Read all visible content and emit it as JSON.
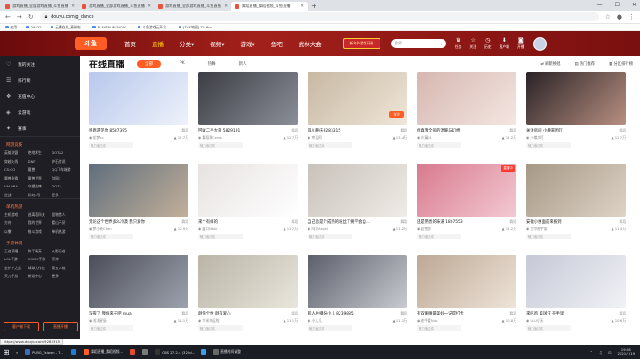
{
  "browser": {
    "tabs": [
      {
        "title": "游戏直播_全部游戏直播_斗鱼直播",
        "active": false
      },
      {
        "title": "游戏直播_全部游戏直播_斗鱼直播",
        "active": false
      },
      {
        "title": "游戏直播_全部游戏直播_斗鱼直播",
        "active": false
      },
      {
        "title": "舞蹈直播_舞蹈视频_斗鱼直播",
        "active": true
      }
    ],
    "url": "douyu.com/g_dance",
    "bookmarks": [
      "应用",
      "29422",
      "云播在线_直播电...",
      "PLAYERUNKNOW...",
      "斗鱼游戏云开发...",
      "[TGS地图] TG Pro..."
    ],
    "window_controls": [
      "—",
      "☐",
      "✕"
    ]
  },
  "header": {
    "logo": "斗鱼",
    "nav": [
      "首页",
      "直播",
      "分类▾",
      "视频▾",
      "游戏▾",
      "鱼吧",
      "武林大会"
    ],
    "nav_selected": 1,
    "promo": "新年节游戏开播",
    "search_placeholder": "搜索",
    "icons": [
      {
        "icon": "trophy-icon",
        "glyph": "♛",
        "label": "任务"
      },
      {
        "icon": "star-icon",
        "glyph": "☆",
        "label": "关注"
      },
      {
        "icon": "history-icon",
        "glyph": "◷",
        "label": "历史"
      },
      {
        "icon": "download-icon",
        "glyph": "⬇",
        "label": "客户端"
      },
      {
        "icon": "camera-icon",
        "glyph": "◙",
        "label": "开播"
      }
    ]
  },
  "sidebar": {
    "items": [
      {
        "icon": "heart-icon",
        "glyph": "♡",
        "label": "我的关注"
      },
      {
        "icon": "list-icon",
        "glyph": "☰",
        "label": "排行榜"
      },
      {
        "icon": "gift-icon",
        "glyph": "❖",
        "label": "充值中心"
      },
      {
        "icon": "game-icon",
        "glyph": "◈",
        "label": "云游戏"
      },
      {
        "icon": "star-icon",
        "glyph": "✦",
        "label": "赛事"
      }
    ],
    "sections": [
      {
        "title": "网游竞技",
        "games": [
          "英雄联盟",
          "绝地求生",
          "DOTA2",
          "穿越火线",
          "DNF",
          "炉石传说",
          "CS:GO",
          "魔兽",
          "QQ飞车端游",
          "魔兽争霸",
          "魔兽世界",
          "剑网3",
          "VALORA...",
          "守望先锋",
          "DOTA",
          "逆战",
          "彩虹6号",
          "更多"
        ]
      },
      {
        "title": "单机热游",
        "games": [
          "主机游戏",
          "逃离塔科夫",
          "怪物猎人",
          "方舟",
          "我的世界",
          "看山不厌",
          "以撒",
          "格斗游戏",
          "单机热游"
        ]
      },
      {
        "title": "手游休闲",
        "games": [
          "王者荣耀",
          "和平精英",
          "火影忍者",
          "LOL手游",
          "CODM手游",
          "原神",
          "金铲铲之战",
          "球球大作战",
          "第五人格",
          "天刀手游",
          "新游中心",
          "更多"
        ]
      }
    ],
    "buttons": [
      "客户端下载",
      "直播开播"
    ]
  },
  "main": {
    "title": "在线直播",
    "chips": [
      "全部",
      "PK",
      "热舞",
      "新人"
    ],
    "selected_chip": 0,
    "right_controls": [
      {
        "icon": "shuffle-icon",
        "glyph": "⇄",
        "label": "刷新换批"
      },
      {
        "icon": "hot-icon",
        "glyph": "▤",
        "label": "热门推荐"
      },
      {
        "icon": "layout-icon",
        "glyph": "▦",
        "label": "分区排行榜"
      }
    ],
    "cards": [
      {
        "title": "感恩遇见你 8587395",
        "category": "舞蹈",
        "streamer": "花梦xx",
        "viewers": "12.7万",
        "tag": "魅力值达成",
        "badge": "",
        "colors": [
          "#b8c8ec",
          "#eef2fb"
        ]
      },
      {
        "title": "回收二手大哥 5829191",
        "category": "舞蹈",
        "streamer": "舞蹈季Ceros",
        "viewers": "12.7万",
        "tag": "魅力值达成",
        "badge": "",
        "colors": [
          "#3c3d45",
          "#8b8f98"
        ]
      },
      {
        "title": "四川重庆9283315",
        "category": "舞蹈",
        "streamer": "幸运阿",
        "viewers": "13.4万",
        "tag": "魅力值达成",
        "badge": "",
        "colors": [
          "#c7b8a3",
          "#efe6d8"
        ],
        "follow": "关注"
      },
      {
        "title": "你喜我全部的温暖与幻想",
        "category": "舞蹈",
        "streamer": "沙漏01",
        "viewers": "11.2万",
        "tag": "魅力值达成",
        "badge": "",
        "colors": [
          "#d6b7b0",
          "#f4e6e2"
        ]
      },
      {
        "title": "关注房间 小樽来团叮",
        "category": "舞蹈",
        "streamer": "小樽大叮",
        "viewers": "11.7万",
        "tag": "魅力值达成",
        "badge": "",
        "colors": [
          "#2a2327",
          "#b88f80"
        ]
      },
      {
        "title": "无论这个世界多么冷漠 我只爱你",
        "category": "舞蹈",
        "streamer": "梦小贤Chan",
        "viewers": "10.9万",
        "tag": "魅力值达成",
        "badge": "",
        "colors": [
          "#5f6e7c",
          "#c3b09a"
        ]
      },
      {
        "title": "来个有缘的",
        "category": "舞蹈",
        "streamer": "圆月Nikki",
        "viewers": "11.7万",
        "tag": "魅力值达成",
        "badge": "",
        "colors": [
          "#e8e2e2",
          "#ffffff"
        ]
      },
      {
        "title": "自己总是个成熟的粉丝了要学会自...",
        "category": "舞蹈",
        "streamer": "阿泠Angel",
        "viewers": "11.2万",
        "tag": "魅力值达成",
        "badge": "",
        "colors": [
          "#c9c2bb",
          "#efebe6"
        ]
      },
      {
        "title": "还是熟悉的味道 1807553",
        "category": "舞蹈",
        "streamer": "夏雪鱼",
        "viewers": "11.2万",
        "tag": "魅力值达成",
        "badge": "直播中",
        "colors": [
          "#d87a8e",
          "#f3c9d2"
        ]
      },
      {
        "title": "安徽小惠面前来报到",
        "category": "舞蹈",
        "streamer": "艾尔图宇宙",
        "viewers": "11.4万",
        "tag": "魅力值达成",
        "badge": "",
        "colors": [
          "#a79886",
          "#ddd3c6"
        ]
      },
      {
        "title": "深夜了 我偷来子吧 mua",
        "category": "舞蹈",
        "streamer": "浅浅星辰",
        "viewers": "11.1万",
        "tag": "魅力值达成",
        "badge": "",
        "colors": [
          "#4b4e58",
          "#9da2ae"
        ]
      },
      {
        "title": "颜值个性 颜有爱心",
        "category": "舞蹈",
        "streamer": "李米辛运啦",
        "viewers": "11.1万",
        "tag": "魅力值达成",
        "badge": "",
        "colors": [
          "#b9b4a6",
          "#e9e6dc"
        ]
      },
      {
        "title": "新人主播呀小儿 8239885",
        "category": "舞蹈",
        "streamer": "小儿儿",
        "viewers": "11.1万",
        "tag": "魅力值达成",
        "badge": "",
        "colors": [
          "#5b5f6a",
          "#c9cbd1"
        ]
      },
      {
        "title": "有双眼睛最美好一记得打卡",
        "category": "舞蹈",
        "streamer": "老牛爱Nuo",
        "viewers": "10.8万",
        "tag": "魅力值达成",
        "badge": "",
        "colors": [
          "#bda894",
          "#eee4d9"
        ]
      },
      {
        "title": "来吃鸡 美国汪 在手里",
        "category": "舞蹈",
        "streamer": "ULU小夭",
        "viewers": "10.6万",
        "tag": "魅力值达成",
        "badge": "",
        "colors": [
          "#c6c9d6",
          "#f1f2f7"
        ]
      }
    ]
  },
  "status_url": "https://www.douyu.com/9283315",
  "taskbar": {
    "start_glyph": "⊞",
    "apps": [
      {
        "label": "PUBG_Taiwan - T...",
        "color": "#3d6db5",
        "wide": true
      },
      {
        "label": "",
        "color": "#1e7bd6",
        "wide": false
      },
      {
        "label": "舞蹈直播_舞蹈视频...",
        "color": "#ff5d23",
        "wide": true
      },
      {
        "label": "",
        "color": "#e54b2e",
        "wide": false
      },
      {
        "label": "",
        "color": "#7a7a7a",
        "wide": false
      },
      {
        "label": "OBS 27.2.4 (32-bi...",
        "color": "#333333",
        "wide": true
      },
      {
        "label": "",
        "color": "#3aa0e8",
        "wide": false
      },
      {
        "label": "直播时间调整",
        "color": "#6a6a6a",
        "wide": true
      }
    ],
    "time": "19:08",
    "date": "2021/1/19"
  }
}
